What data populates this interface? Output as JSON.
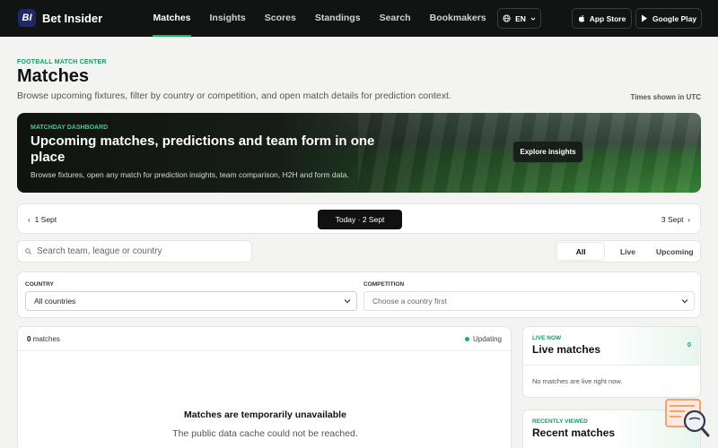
{
  "brand": {
    "name": "Bet Insider",
    "logo_text": "BI"
  },
  "nav": {
    "items": [
      "Matches",
      "Insights",
      "Scores",
      "Standings",
      "Search",
      "Bookmakers"
    ],
    "active": "Matches"
  },
  "language": {
    "code": "EN",
    "icon": "globe-icon"
  },
  "stores": {
    "apple": "App Store",
    "google": "Google Play"
  },
  "header": {
    "eyebrow": "FOOTBALL MATCH CENTER",
    "title": "Matches",
    "subtitle": "Browse upcoming fixtures, filter by country or competition, and open match details for prediction context.",
    "timezone_note": "Times shown in UTC"
  },
  "hero": {
    "eyebrow": "MATCHDAY DASHBOARD",
    "title": "Upcoming matches, predictions and team form in one place",
    "text": "Browse fixtures, open any match for prediction insights, team comparison, H2H and form data.",
    "cta": "Explore insights"
  },
  "dates": {
    "prev": "1 Sept",
    "current": "Today · 2 Sept",
    "next": "3 Sept"
  },
  "search": {
    "placeholder": "Search team, league or country"
  },
  "status_tabs": {
    "items": [
      "All",
      "Live",
      "Upcoming"
    ],
    "active": "All"
  },
  "filters": {
    "country_label": "COUNTRY",
    "country_value": "All countries",
    "competition_label": "COMPETITION",
    "competition_value": "Choose a country first"
  },
  "matches": {
    "count": "0",
    "count_label": "matches",
    "status": "Updating",
    "empty_title": "Matches are temporarily unavailable",
    "empty_text": "The public data cache could not be reached."
  },
  "live_card": {
    "eyebrow": "LIVE NOW",
    "title": "Live matches",
    "count": "0",
    "empty": "No matches are live right now."
  },
  "recent_card": {
    "eyebrow": "RECENTLY VIEWED",
    "title": "Recent matches"
  },
  "colors": {
    "accent": "#1fae6e",
    "topbar": "#121413",
    "background": "#f3f4f2"
  }
}
